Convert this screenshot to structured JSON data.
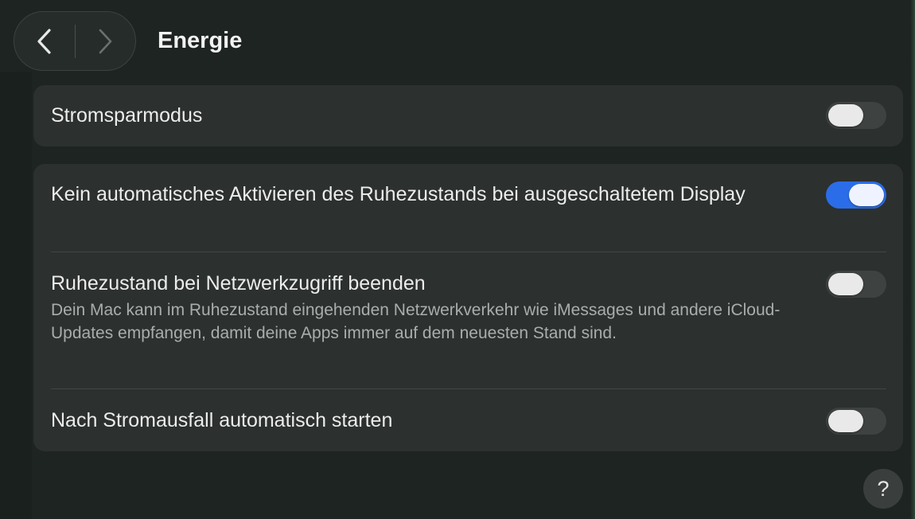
{
  "header": {
    "title": "Energie",
    "back_icon": "chevron-left-icon",
    "forward_icon": "chevron-right-icon"
  },
  "settings": {
    "low_power": {
      "label": "Stromsparmodus",
      "enabled": false
    },
    "prevent_sleep": {
      "label": "Kein automatisches Aktivieren des Ruhezustands bei ausgeschaltetem Display",
      "enabled": true
    },
    "wake_for_network": {
      "label": "Ruhezustand bei Netzwerkzugriff beenden",
      "description": "Dein Mac kann im Ruhezustand eingehenden Netzwerkverkehr wie iMessages und andere iCloud-Updates empfangen, damit deine Apps immer auf dem neuesten Stand sind.",
      "enabled": false
    },
    "auto_restart": {
      "label": "Nach Stromausfall automatisch starten",
      "enabled": false
    }
  },
  "help": {
    "label": "?"
  },
  "colors": {
    "background": "#1e2421",
    "card": "#2c302e",
    "toggle_on": "#2b6de8",
    "toggle_off": "#3e4240"
  }
}
